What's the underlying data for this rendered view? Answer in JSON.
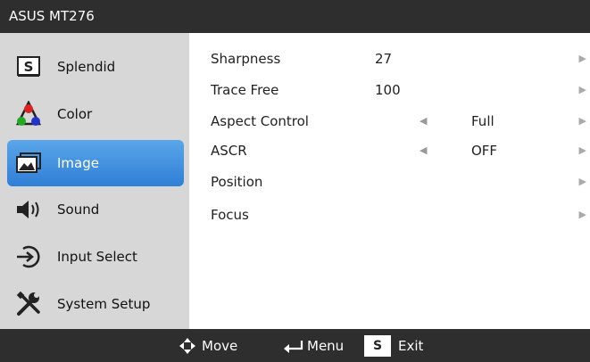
{
  "window": {
    "title": "ASUS MT276"
  },
  "sidebar": {
    "items": [
      {
        "label": "Splendid",
        "icon": "splendid-s-icon",
        "active": false
      },
      {
        "label": "Color",
        "icon": "color-rgb-icon",
        "active": false
      },
      {
        "label": "Image",
        "icon": "image-icon",
        "active": true
      },
      {
        "label": "Sound",
        "icon": "speaker-icon",
        "active": false
      },
      {
        "label": "Input Select",
        "icon": "input-select-icon",
        "active": false
      },
      {
        "label": "System Setup",
        "icon": "wrench-screwdriver-icon",
        "active": false
      }
    ]
  },
  "settings": [
    {
      "label": "Sharpness",
      "value": "27"
    },
    {
      "label": "Trace Free",
      "value": "100"
    },
    {
      "label": "Aspect Control",
      "value": "Full"
    },
    {
      "label": "ASCR",
      "value": "OFF"
    },
    {
      "label": "Position",
      "value": ""
    },
    {
      "label": "Focus",
      "value": ""
    }
  ],
  "footer": {
    "move": "Move",
    "menu": "Menu",
    "exit_key": "S",
    "exit": "Exit"
  },
  "colors": {
    "bar": "#2e2e2e",
    "sidebar": "#d7d7d7",
    "active": "#3b8ee0"
  }
}
